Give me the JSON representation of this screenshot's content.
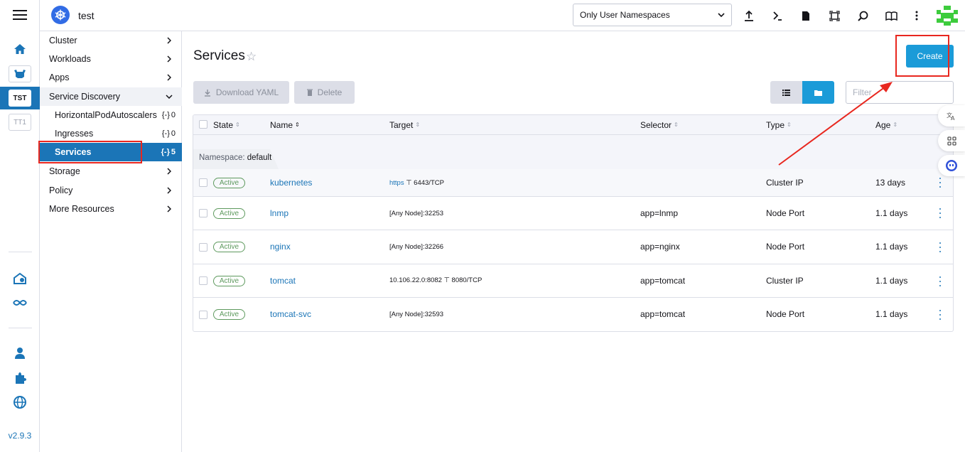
{
  "app": {
    "cluster_name": "test",
    "version": "v2.9.3",
    "rail_clusters": [
      "TST",
      "TT1"
    ]
  },
  "header": {
    "namespace_filter": "Only User Namespaces",
    "icons": [
      "import-yaml-icon",
      "kubectl-shell-icon",
      "kubeconfig-download-icon",
      "copy-kubeconfig-icon",
      "search-resources-icon",
      "docs-icon",
      "more-icon"
    ]
  },
  "sidenav": {
    "groups": [
      {
        "label": "Cluster"
      },
      {
        "label": "Workloads"
      },
      {
        "label": "Apps"
      },
      {
        "label": "Service Discovery",
        "expanded": true
      },
      {
        "label": "Storage"
      },
      {
        "label": "Policy"
      },
      {
        "label": "More Resources"
      }
    ],
    "children": [
      {
        "label": "HorizontalPodAutoscalers",
        "count": "0"
      },
      {
        "label": "Ingresses",
        "count": "0"
      },
      {
        "label": "Services",
        "count": "5",
        "active": true
      }
    ]
  },
  "page": {
    "title": "Services",
    "create_label": "Create",
    "download_yaml_label": "Download YAML",
    "delete_label": "Delete",
    "filter_placeholder": "Filter"
  },
  "table": {
    "columns": [
      "State",
      "Name",
      "Target",
      "Selector",
      "Type",
      "Age"
    ],
    "namespace_label": "Namespace:",
    "namespace_value": "default",
    "rows": [
      {
        "state": "Active",
        "name": "kubernetes",
        "target_prefix": "https",
        "target": "6443/TCP",
        "selector": "",
        "type": "Cluster IP",
        "age": "13 days"
      },
      {
        "state": "Active",
        "name": "lnmp",
        "target_prefix": "",
        "target": "[Any Node]:32253",
        "selector": "app=lnmp",
        "type": "Node Port",
        "age": "1.1 days"
      },
      {
        "state": "Active",
        "name": "nginx",
        "target_prefix": "",
        "target": "[Any Node]:32266",
        "selector": "app=nginx",
        "type": "Node Port",
        "age": "1.1 days"
      },
      {
        "state": "Active",
        "name": "tomcat",
        "target_prefix": "10.106.22.0:8082",
        "target": "8080/TCP",
        "selector": "app=tomcat",
        "type": "Cluster IP",
        "age": "1.1 days"
      },
      {
        "state": "Active",
        "name": "tomcat-svc",
        "target_prefix": "",
        "target": "[Any Node]:32593",
        "selector": "app=tomcat",
        "type": "Node Port",
        "age": "1.1 days"
      }
    ]
  },
  "colors": {
    "accent": "#1b9bd8",
    "active_nav": "#1b75b7",
    "active_badge": "#5d995d",
    "annotation": "#e8271f"
  }
}
